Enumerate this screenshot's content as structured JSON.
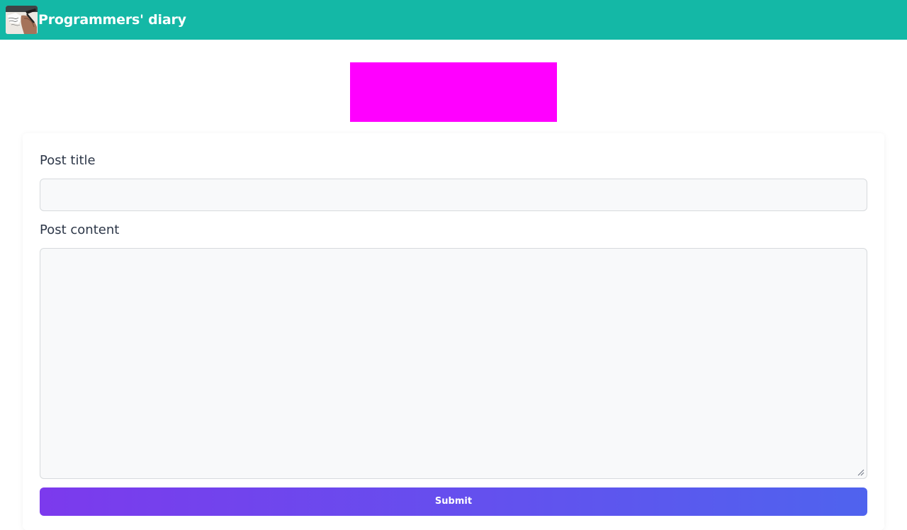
{
  "navbar": {
    "brand": "Programmers' diary",
    "logo_icon": "writing-hand-photo-icon",
    "background_color": "#14b8a6"
  },
  "banner": {
    "color": "#ff00ff"
  },
  "form": {
    "title_label": "Post title",
    "title_value": "",
    "title_placeholder": "",
    "content_label": "Post content",
    "content_value": "",
    "content_placeholder": "",
    "submit_label": "Submit",
    "submit_gradient": [
      "#7c3aed",
      "#4f63ee"
    ]
  }
}
